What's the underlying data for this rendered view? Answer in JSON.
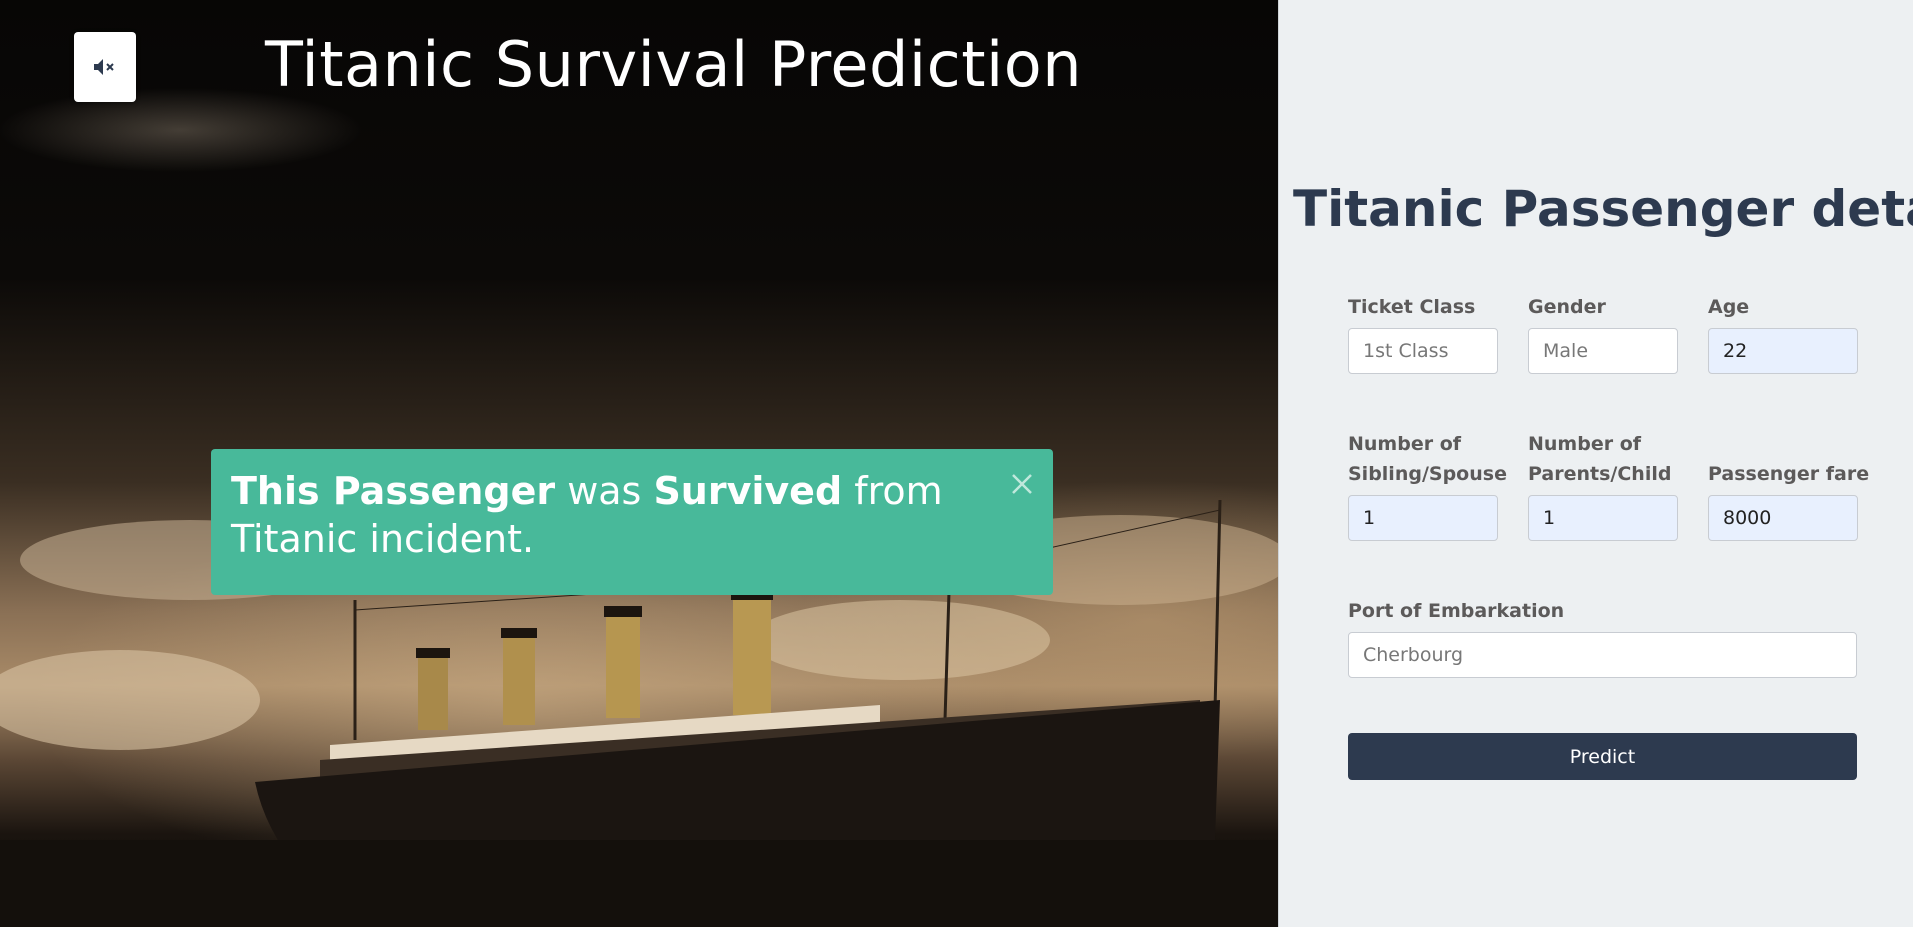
{
  "header": {
    "title": "Titanic Survival Prediction",
    "mute_icon": "volume-mute-icon"
  },
  "alert": {
    "part1_bold": "This Passenger",
    "part2": " was ",
    "part3_bold": "Survived",
    "part4": " from Titanic incident.",
    "close_icon": "close-icon",
    "color": "#48b99a"
  },
  "form": {
    "title": "Titanic Passenger details",
    "ticket_class": {
      "label": "Ticket Class",
      "placeholder": "1st Class",
      "value": ""
    },
    "gender": {
      "label": "Gender",
      "placeholder": "Male",
      "value": ""
    },
    "age": {
      "label": "Age",
      "value": "22"
    },
    "siblings": {
      "label_line1": "Number of",
      "label_line2": "Sibling/Spouse",
      "value": "1"
    },
    "parents": {
      "label_line1": "Number of",
      "label_line2": "Parents/Child",
      "value": "1"
    },
    "fare": {
      "label": "Passenger fare",
      "value": "8000"
    },
    "embarkation": {
      "label": "Port of Embarkation",
      "placeholder": "Cherbourg",
      "value": ""
    },
    "predict_label": "Predict"
  },
  "colors": {
    "primary": "#2d3a4f",
    "panel_bg": "#edf0f2"
  }
}
